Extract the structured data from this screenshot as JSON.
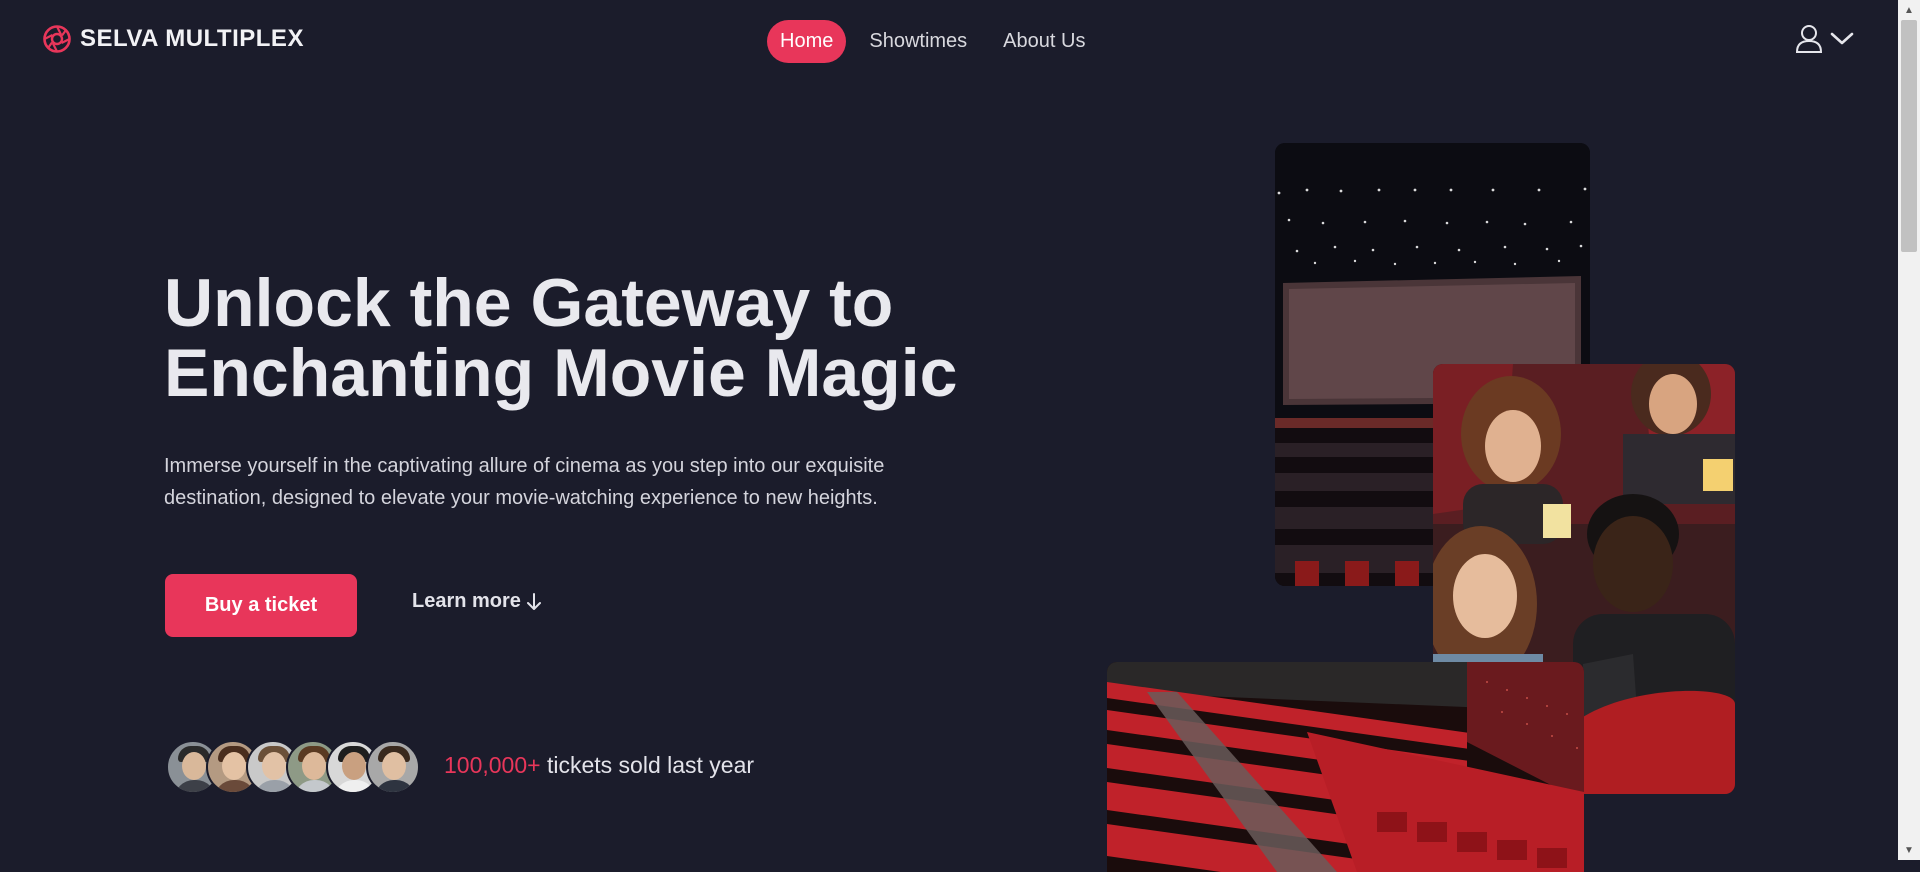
{
  "brand": {
    "name": "SELVA MULTIPLEX",
    "icon": "aperture-icon",
    "accent": "#e8365a"
  },
  "nav": {
    "items": [
      {
        "label": "Home",
        "active": true
      },
      {
        "label": "Showtimes",
        "active": false
      },
      {
        "label": "About Us",
        "active": false
      }
    ]
  },
  "user_menu": {
    "icon": "user-icon",
    "dropdown_icon": "chevron-down-icon"
  },
  "hero": {
    "title_line1": "Unlock the Gateway to",
    "title_line2": "Enchanting Movie Magic",
    "description": "Immerse yourself in the captivating allure of cinema as you step into our exquisite destination, designed to elevate your movie-watching experience to new heights.",
    "primary_button": "Buy a ticket",
    "secondary_link": "Learn more",
    "secondary_icon": "arrow-down-icon"
  },
  "stats": {
    "count": "100,000+",
    "text": "tickets sold last year"
  },
  "colors": {
    "background": "#1b1c2b",
    "accent": "#e8365a",
    "text": "#e6e6ec"
  }
}
